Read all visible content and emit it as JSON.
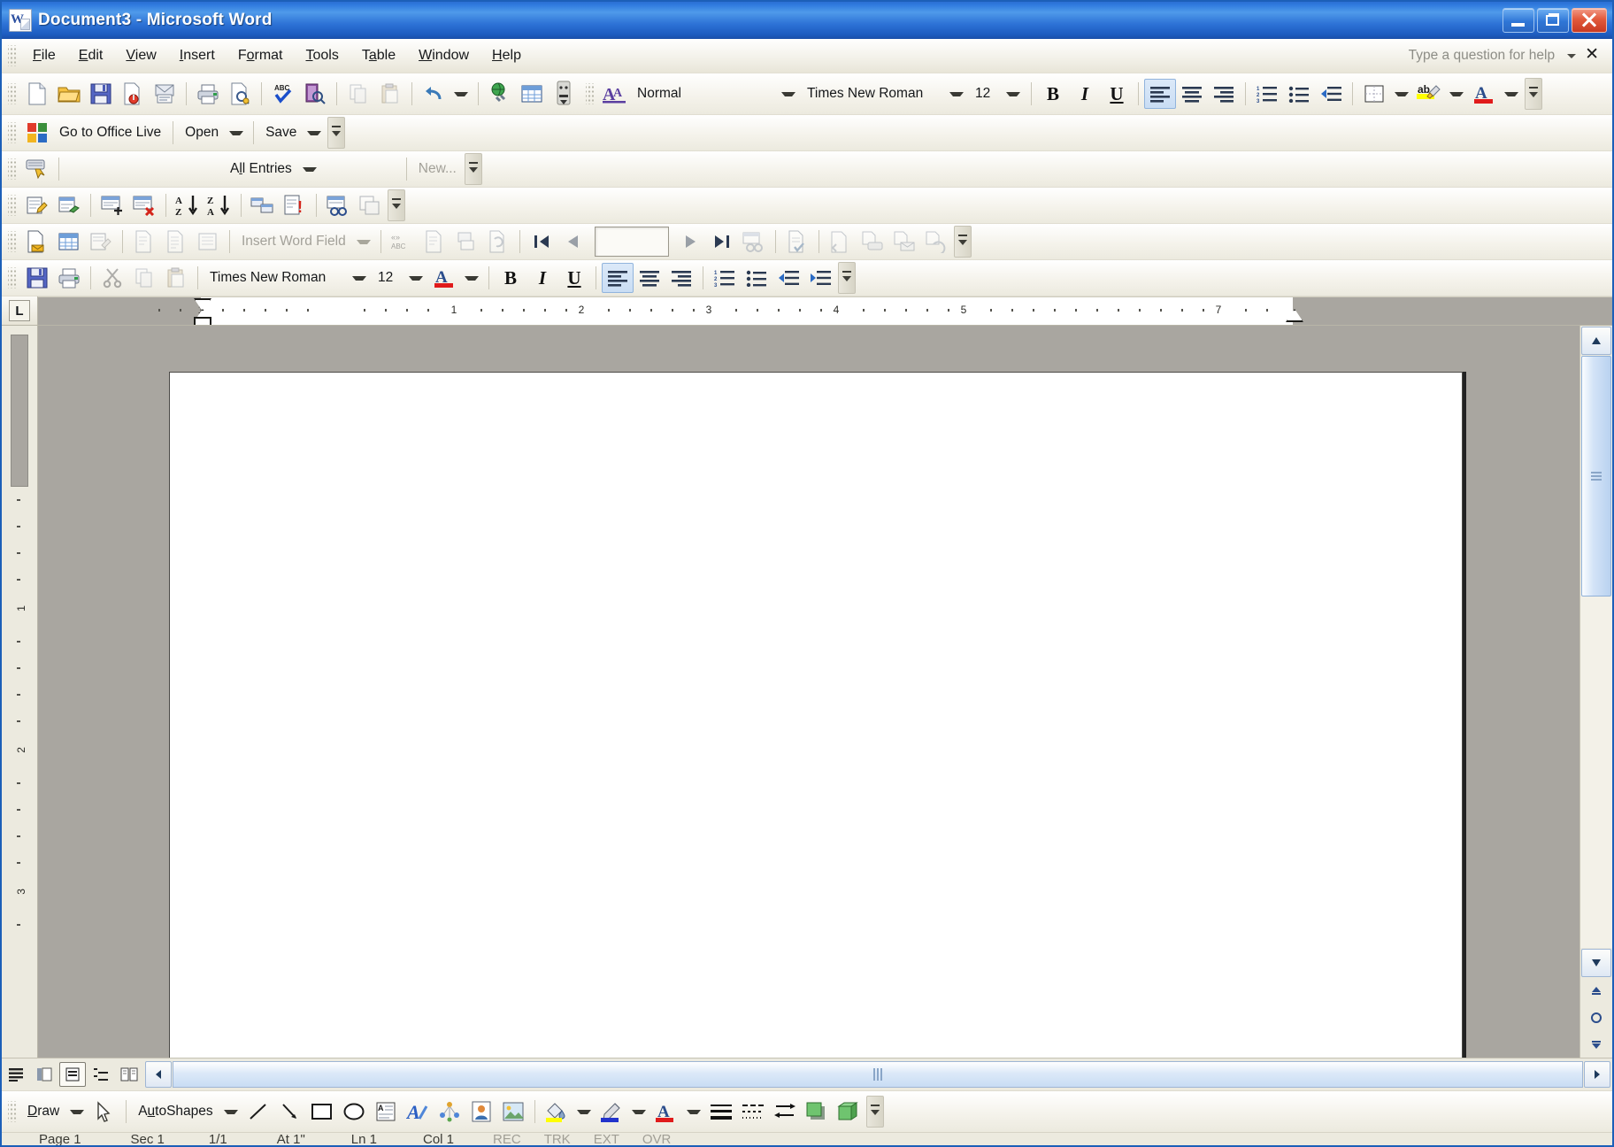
{
  "window": {
    "title_doc": "Document3",
    "title_sep": " - ",
    "title_app": "Microsoft Word",
    "logo_icon": "word-document-icon",
    "minimize_label": "Minimize",
    "restore_label": "Restore Down",
    "close_label": "Close"
  },
  "menubar": {
    "items": [
      {
        "label": "File",
        "accel": "F"
      },
      {
        "label": "Edit",
        "accel": "E"
      },
      {
        "label": "View",
        "accel": "V"
      },
      {
        "label": "Insert",
        "accel": "I"
      },
      {
        "label": "Format",
        "accel": "o"
      },
      {
        "label": "Tools",
        "accel": "T"
      },
      {
        "label": "Table",
        "accel": "a"
      },
      {
        "label": "Window",
        "accel": "W"
      },
      {
        "label": "Help",
        "accel": "H"
      }
    ],
    "help_placeholder": "Type a question for help",
    "close_doc_label": "✕"
  },
  "standard_toolbar": {
    "name": "Standard",
    "buttons": [
      {
        "name": "new-blank-document-button",
        "label": "New Blank Document"
      },
      {
        "name": "open-button",
        "label": "Open"
      },
      {
        "name": "save-button",
        "label": "Save"
      },
      {
        "name": "permission-button",
        "label": "Permission"
      },
      {
        "name": "email-button",
        "label": "E-mail"
      },
      {
        "name": "print-button",
        "label": "Print"
      },
      {
        "name": "print-preview-button",
        "label": "Print Preview"
      },
      {
        "name": "spelling-grammar-button",
        "label": "Spelling and Grammar"
      },
      {
        "name": "research-button",
        "label": "Research"
      },
      {
        "name": "copy-button",
        "label": "Copy"
      },
      {
        "name": "paste-button",
        "label": "Paste"
      },
      {
        "name": "undo-button",
        "label": "Undo"
      },
      {
        "name": "insert-hyperlink-button",
        "label": "Insert Hyperlink"
      },
      {
        "name": "insert-table-button",
        "label": "Insert Table"
      },
      {
        "name": "show-formatting-button",
        "label": "Show/Hide"
      }
    ]
  },
  "formatting_toolbar": {
    "name": "Formatting",
    "style_icon_label": "Styles and Formatting",
    "style": "Normal",
    "font": "Times New Roman",
    "size": "12",
    "bold": "B",
    "italic": "I",
    "underline": "U",
    "align_left_active": true,
    "buttons": [
      {
        "name": "align-left-button",
        "label": "Align Left"
      },
      {
        "name": "center-button",
        "label": "Center"
      },
      {
        "name": "align-right-button",
        "label": "Align Right"
      },
      {
        "name": "numbering-button",
        "label": "Numbering"
      },
      {
        "name": "bullets-button",
        "label": "Bullets"
      },
      {
        "name": "decrease-indent-button",
        "label": "Decrease Indent"
      },
      {
        "name": "borders-button",
        "label": "Outside Border"
      },
      {
        "name": "highlight-button",
        "label": "Highlight"
      },
      {
        "name": "font-color-button",
        "label": "Font Color"
      }
    ]
  },
  "office_live_toolbar": {
    "name": "Office Live",
    "icon": "office-live-icon",
    "go_label": "Go to Office Live",
    "open_label": "Open",
    "save_label": "Save"
  },
  "autotext_toolbar": {
    "name": "AutoText",
    "icon": "autotext-icon",
    "all_entries_label": "All Entries",
    "new_label": "New...",
    "new_enabled": false
  },
  "database_toolbar": {
    "name": "Database",
    "buttons": [
      {
        "name": "edit-data-source-button",
        "label": "Manage Fields"
      },
      {
        "name": "data-form-button",
        "label": "Data Form"
      },
      {
        "name": "add-new-record-button",
        "label": "Add New Record"
      },
      {
        "name": "delete-record-button",
        "label": "Delete Record"
      },
      {
        "name": "sort-ascending-button",
        "label": "Sort Ascending"
      },
      {
        "name": "sort-descending-button",
        "label": "Sort Descending"
      },
      {
        "name": "insert-database-button",
        "label": "Insert Database"
      },
      {
        "name": "update-fields-button",
        "label": "Update Fields"
      },
      {
        "name": "find-record-button",
        "label": "Find Record"
      },
      {
        "name": "mail-merge-main-document-button",
        "label": "Mail Merge Main Document"
      }
    ]
  },
  "mailmerge_toolbar": {
    "name": "Mail Merge",
    "insert_word_field_label": "Insert Word Field",
    "record_value": "",
    "buttons": [
      {
        "name": "main-document-setup-button",
        "label": "Main document setup"
      },
      {
        "name": "open-data-source-button",
        "label": "Open Data Source"
      },
      {
        "name": "mail-merge-recipients-button",
        "label": "Mail Merge Recipients"
      },
      {
        "name": "insert-address-block-button",
        "label": "Insert Address Block"
      },
      {
        "name": "insert-greeting-line-button",
        "label": "Insert Greeting Line"
      },
      {
        "name": "insert-merge-fields-button",
        "label": "Insert Merge Fields"
      },
      {
        "name": "view-merged-data-button",
        "label": "View Merged Data"
      },
      {
        "name": "highlight-merge-fields-button",
        "label": "Highlight Merge Fields"
      },
      {
        "name": "match-fields-button",
        "label": "Match Fields"
      },
      {
        "name": "propagate-labels-button",
        "label": "Propagate Labels"
      },
      {
        "name": "first-record-button",
        "label": "First Record"
      },
      {
        "name": "previous-record-button",
        "label": "Previous Record"
      },
      {
        "name": "next-record-button",
        "label": "Next Record"
      },
      {
        "name": "last-record-button",
        "label": "Last Record"
      },
      {
        "name": "find-entry-button",
        "label": "Find Entry"
      },
      {
        "name": "check-for-errors-button",
        "label": "Check for Errors"
      },
      {
        "name": "merge-to-new-document-button",
        "label": "Merge to New Document"
      },
      {
        "name": "merge-to-printer-button",
        "label": "Merge to Printer"
      },
      {
        "name": "merge-to-email-button",
        "label": "Merge to E-mail"
      },
      {
        "name": "merge-to-fax-button",
        "label": "Merge to Fax"
      }
    ]
  },
  "formatting_toolbar2": {
    "name": "Formatting (second row)",
    "font": "Times New Roman",
    "size": "12",
    "bold": "B",
    "italic": "I",
    "underline": "U",
    "buttons": [
      {
        "name": "save-button",
        "label": "Save"
      },
      {
        "name": "print-button",
        "label": "Print"
      },
      {
        "name": "cut-button",
        "label": "Cut"
      },
      {
        "name": "copy-button",
        "label": "Copy"
      },
      {
        "name": "paste-button",
        "label": "Paste"
      },
      {
        "name": "font-color-button",
        "label": "Font Color"
      },
      {
        "name": "align-left-button",
        "label": "Align Left"
      },
      {
        "name": "center-button",
        "label": "Center"
      },
      {
        "name": "align-right-button",
        "label": "Align Right"
      },
      {
        "name": "numbering-button",
        "label": "Numbering"
      },
      {
        "name": "bullets-button",
        "label": "Bullets"
      },
      {
        "name": "decrease-indent-button",
        "label": "Decrease Indent"
      },
      {
        "name": "increase-indent-button",
        "label": "Increase Indent"
      }
    ]
  },
  "ruler": {
    "tab_stop_label": "L",
    "h_numbers": [
      "1",
      "1",
      "2",
      "3",
      "4",
      "5",
      "7"
    ],
    "v_numbers": [
      "1",
      "2",
      "3"
    ]
  },
  "document": {
    "page_content": "",
    "view_buttons": [
      {
        "name": "normal-view-button",
        "label": "Normal View"
      },
      {
        "name": "web-layout-view-button",
        "label": "Web Layout View"
      },
      {
        "name": "print-layout-view-button",
        "label": "Print Layout View",
        "active": true
      },
      {
        "name": "outline-view-button",
        "label": "Outline View"
      },
      {
        "name": "reading-layout-button",
        "label": "Reading Layout"
      }
    ]
  },
  "drawing_toolbar": {
    "name": "Drawing",
    "draw_label": "Draw",
    "autoshapes_label": "AutoShapes",
    "buttons": [
      {
        "name": "select-objects-button",
        "label": "Select Objects"
      },
      {
        "name": "line-button",
        "label": "Line"
      },
      {
        "name": "arrow-button",
        "label": "Arrow"
      },
      {
        "name": "rectangle-button",
        "label": "Rectangle"
      },
      {
        "name": "oval-button",
        "label": "Oval"
      },
      {
        "name": "text-box-button",
        "label": "Text Box"
      },
      {
        "name": "insert-wordart-button",
        "label": "Insert WordArt"
      },
      {
        "name": "insert-diagram-button",
        "label": "Insert Diagram or Organization Chart"
      },
      {
        "name": "insert-clip-art-button",
        "label": "Insert Clip Art"
      },
      {
        "name": "insert-picture-button",
        "label": "Insert Picture"
      },
      {
        "name": "fill-color-button",
        "label": "Fill Color"
      },
      {
        "name": "line-color-button",
        "label": "Line Color"
      },
      {
        "name": "font-color-button",
        "label": "Font Color"
      },
      {
        "name": "line-style-button",
        "label": "Line Style"
      },
      {
        "name": "dash-style-button",
        "label": "Dash Style"
      },
      {
        "name": "arrow-style-button",
        "label": "Arrow Style"
      },
      {
        "name": "shadow-style-button",
        "label": "Shadow Style"
      },
      {
        "name": "3d-style-button",
        "label": "3-D Style"
      }
    ]
  },
  "statusbar": {
    "page": "Page 1",
    "sec": "Sec 1",
    "pages": "1/1",
    "at": "At 1\"",
    "line": "Ln 1",
    "col": "Col 1",
    "rec": "REC",
    "trk": "TRK",
    "ext": "EXT",
    "ovr": "OVR"
  },
  "colors": {
    "title_blue": "#2f7ade",
    "toolbar_bg": "#f4f2ea",
    "page_bg": "#a9a6a0",
    "accent_highlight": "#ffff00",
    "font_color_red": "#e01b1b",
    "line_color_blue": "#2233cc"
  }
}
